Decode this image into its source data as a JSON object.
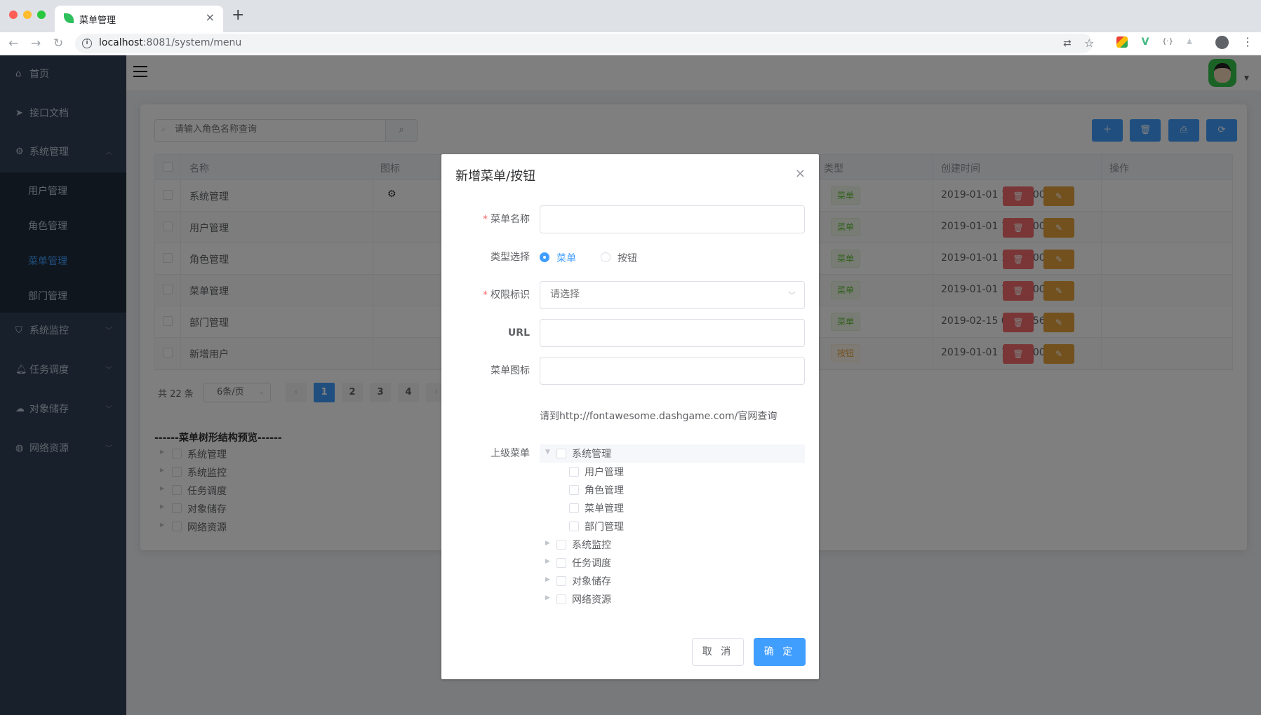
{
  "browser": {
    "tab_title": "菜单管理",
    "new_tab": "+",
    "close_tab": "×",
    "url_host": "localhost",
    "url_rest": ":8081/system/menu",
    "icons": [
      "back-icon",
      "forward-icon",
      "reload-icon",
      "info-icon",
      "translate-icon",
      "bookmark-star-icon",
      "extension-icon",
      "vue-devtools-icon",
      "extension-braces-icon",
      "profile-icon",
      "menu-kebab-icon"
    ]
  },
  "sidebar": {
    "items": [
      {
        "label": "首页",
        "icon": "home-icon"
      },
      {
        "label": "接口文档",
        "icon": "send-icon"
      },
      {
        "label": "系统管理",
        "icon": "gear-icon"
      },
      {
        "label": "系统监控",
        "icon": "shield-icon"
      },
      {
        "label": "任务调度",
        "icon": "bell-icon"
      },
      {
        "label": "对象储存",
        "icon": "cloud-icon"
      },
      {
        "label": "网络资源",
        "icon": "globe-icon"
      }
    ],
    "submenu": [
      "用户管理",
      "角色管理",
      "菜单管理",
      "部门管理"
    ],
    "active": "菜单管理",
    "colors": {
      "bg": "#304156",
      "submenu_bg": "#1f2d3d",
      "text": "#bfcbd9",
      "active": "#409eff"
    }
  },
  "toolbar": {
    "search_placeholder": "请输入角色名称查询",
    "buttons": [
      "add-icon",
      "delete-icon",
      "print-icon",
      "refresh-icon"
    ]
  },
  "table": {
    "headers": {
      "name": "名称",
      "icon": "图标",
      "type": "类型",
      "created": "创建时间",
      "ops": "操作"
    },
    "rows": [
      {
        "name": "系统管理",
        "icon": "gear-icon",
        "type": "菜单",
        "created": "2019-01-01 14:00:00"
      },
      {
        "name": "用户管理",
        "icon": "",
        "type": "菜单",
        "created": "2019-01-01 14:00:00"
      },
      {
        "name": "角色管理",
        "icon": "",
        "type": "菜单",
        "created": "2019-01-01 14:00:00"
      },
      {
        "name": "菜单管理",
        "icon": "",
        "type": "菜单",
        "created": "2019-01-01 14:00:00"
      },
      {
        "name": "部门管理",
        "icon": "",
        "type": "菜单",
        "created": "2019-02-15 03:19:56"
      },
      {
        "name": "新增用户",
        "icon": "",
        "type": "按钮",
        "created": "2019-01-01 14:00:00"
      }
    ]
  },
  "pagination": {
    "total": "共 22 条",
    "page_size": "6条/页",
    "pages": [
      "1",
      "2",
      "3",
      "4"
    ],
    "current": "1",
    "prev": "‹",
    "next": "›"
  },
  "preview": {
    "title": "------菜单树形结构预览------",
    "items": [
      "系统管理",
      "系统监控",
      "任务调度",
      "对象储存",
      "网络资源"
    ]
  },
  "dialog": {
    "title": "新增菜单/按钮",
    "close": "×",
    "fields": {
      "name_label": "菜单名称",
      "name_value": "",
      "type_label": "类型选择",
      "type_options": [
        "菜单",
        "按钮"
      ],
      "type_selected": "菜单",
      "perm_label": "权限标识",
      "perm_placeholder": "请选择",
      "url_label": "URL",
      "url_value": "",
      "icon_label": "菜单图标",
      "icon_value": "",
      "icon_hint": "请到http://fontawesome.dashgame.com/官网查询",
      "parent_label": "上级菜单"
    },
    "tree": {
      "root": "系统管理",
      "children": [
        "用户管理",
        "角色管理",
        "菜单管理",
        "部门管理"
      ],
      "others": [
        "系统监控",
        "任务调度",
        "对象储存",
        "网络资源"
      ]
    },
    "buttons": {
      "cancel": "取 消",
      "ok": "确 定"
    }
  },
  "required_mark": "*"
}
